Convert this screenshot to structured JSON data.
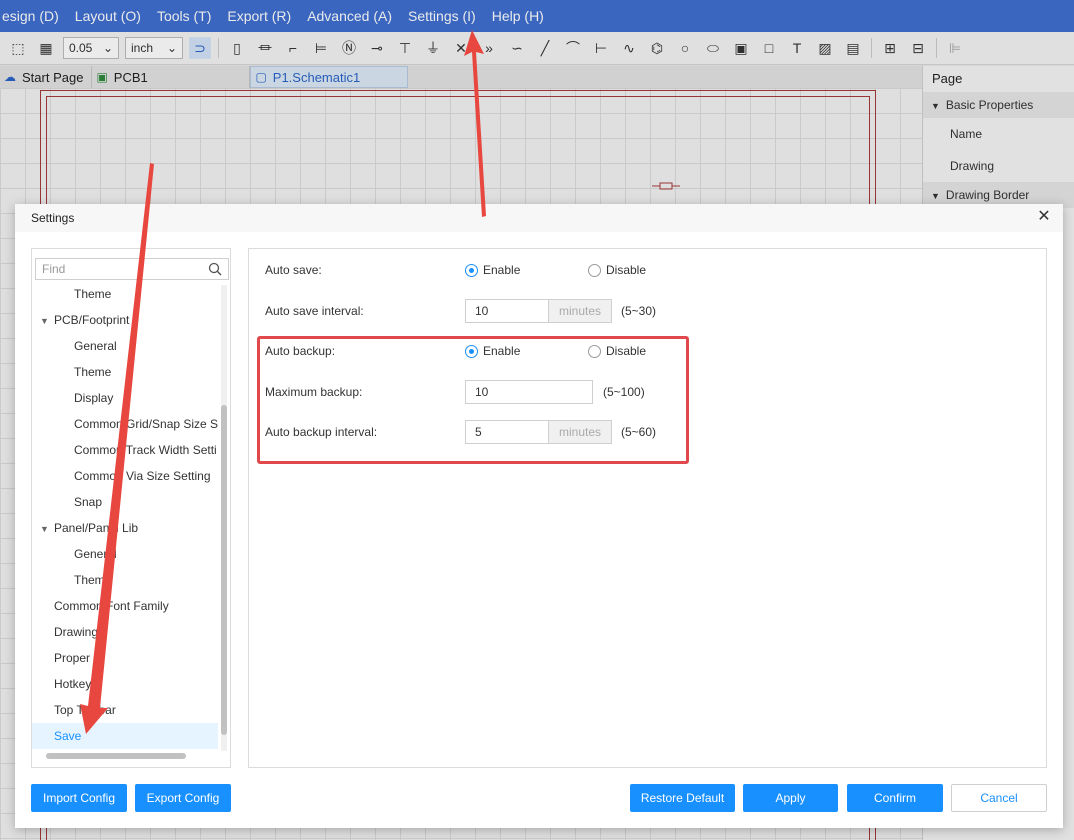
{
  "menubar": {
    "items": [
      "esign (D)",
      "Layout (O)",
      "Tools (T)",
      "Export (R)",
      "Advanced (A)",
      "Settings (I)",
      "Help (H)"
    ]
  },
  "toolbar": {
    "grid_value": "0.05",
    "unit_value": "inch"
  },
  "tabs": [
    {
      "label": "Start Page"
    },
    {
      "label": "PCB1"
    },
    {
      "label": "P1.Schematic1"
    }
  ],
  "right_panel": {
    "title": "Page",
    "section1": "Basic Properties",
    "rows": [
      "Name",
      "Drawing"
    ],
    "section2": "Drawing Border"
  },
  "dialog": {
    "title": "Settings",
    "find_placeholder": "Find",
    "tree": [
      {
        "label": "Theme",
        "level": 2
      },
      {
        "label": "PCB/Footprint",
        "level": 1,
        "expanded": true
      },
      {
        "label": "General",
        "level": 2
      },
      {
        "label": "Theme",
        "level": 2
      },
      {
        "label": "Display",
        "level": 2
      },
      {
        "label": "Common Grid/Snap Size S",
        "level": 2
      },
      {
        "label": "Common Track Width Setti",
        "level": 2
      },
      {
        "label": "Common Via Size Setting",
        "level": 2
      },
      {
        "label": "Snap",
        "level": 2
      },
      {
        "label": "Panel/Panel Lib",
        "level": 1,
        "expanded": true
      },
      {
        "label": "General",
        "level": 2
      },
      {
        "label": "Theme",
        "level": 2
      },
      {
        "label": "Common Font Family",
        "level": 1
      },
      {
        "label": "Drawing",
        "level": 1
      },
      {
        "label": "Proper",
        "level": 1
      },
      {
        "label": "Hotkey",
        "level": 1
      },
      {
        "label": "Top Toolbar",
        "level": 1
      },
      {
        "label": "Save",
        "level": 1,
        "selected": true
      }
    ],
    "auto_save": {
      "label": "Auto save:",
      "enable": "Enable",
      "disable": "Disable",
      "selected": "enable"
    },
    "auto_save_interval": {
      "label": "Auto save interval:",
      "value": "10",
      "unit": "minutes",
      "range": "(5~30)"
    },
    "auto_backup": {
      "label": "Auto backup:",
      "enable": "Enable",
      "disable": "Disable",
      "selected": "enable"
    },
    "maximum_backup": {
      "label": "Maximum backup:",
      "value": "10",
      "range": "(5~100)"
    },
    "auto_backup_interval": {
      "label": "Auto backup interval:",
      "value": "5",
      "unit": "minutes",
      "range": "(5~60)"
    },
    "buttons": {
      "import_config": "Import Config",
      "export_config": "Export Config",
      "restore_default": "Restore Default",
      "apply": "Apply",
      "confirm": "Confirm",
      "cancel": "Cancel"
    }
  },
  "colors": {
    "menubar_bg": "#3f6fd1",
    "primary": "#1890ff",
    "highlight": "#e0484b",
    "annotation_arrow": "#e8473f"
  }
}
